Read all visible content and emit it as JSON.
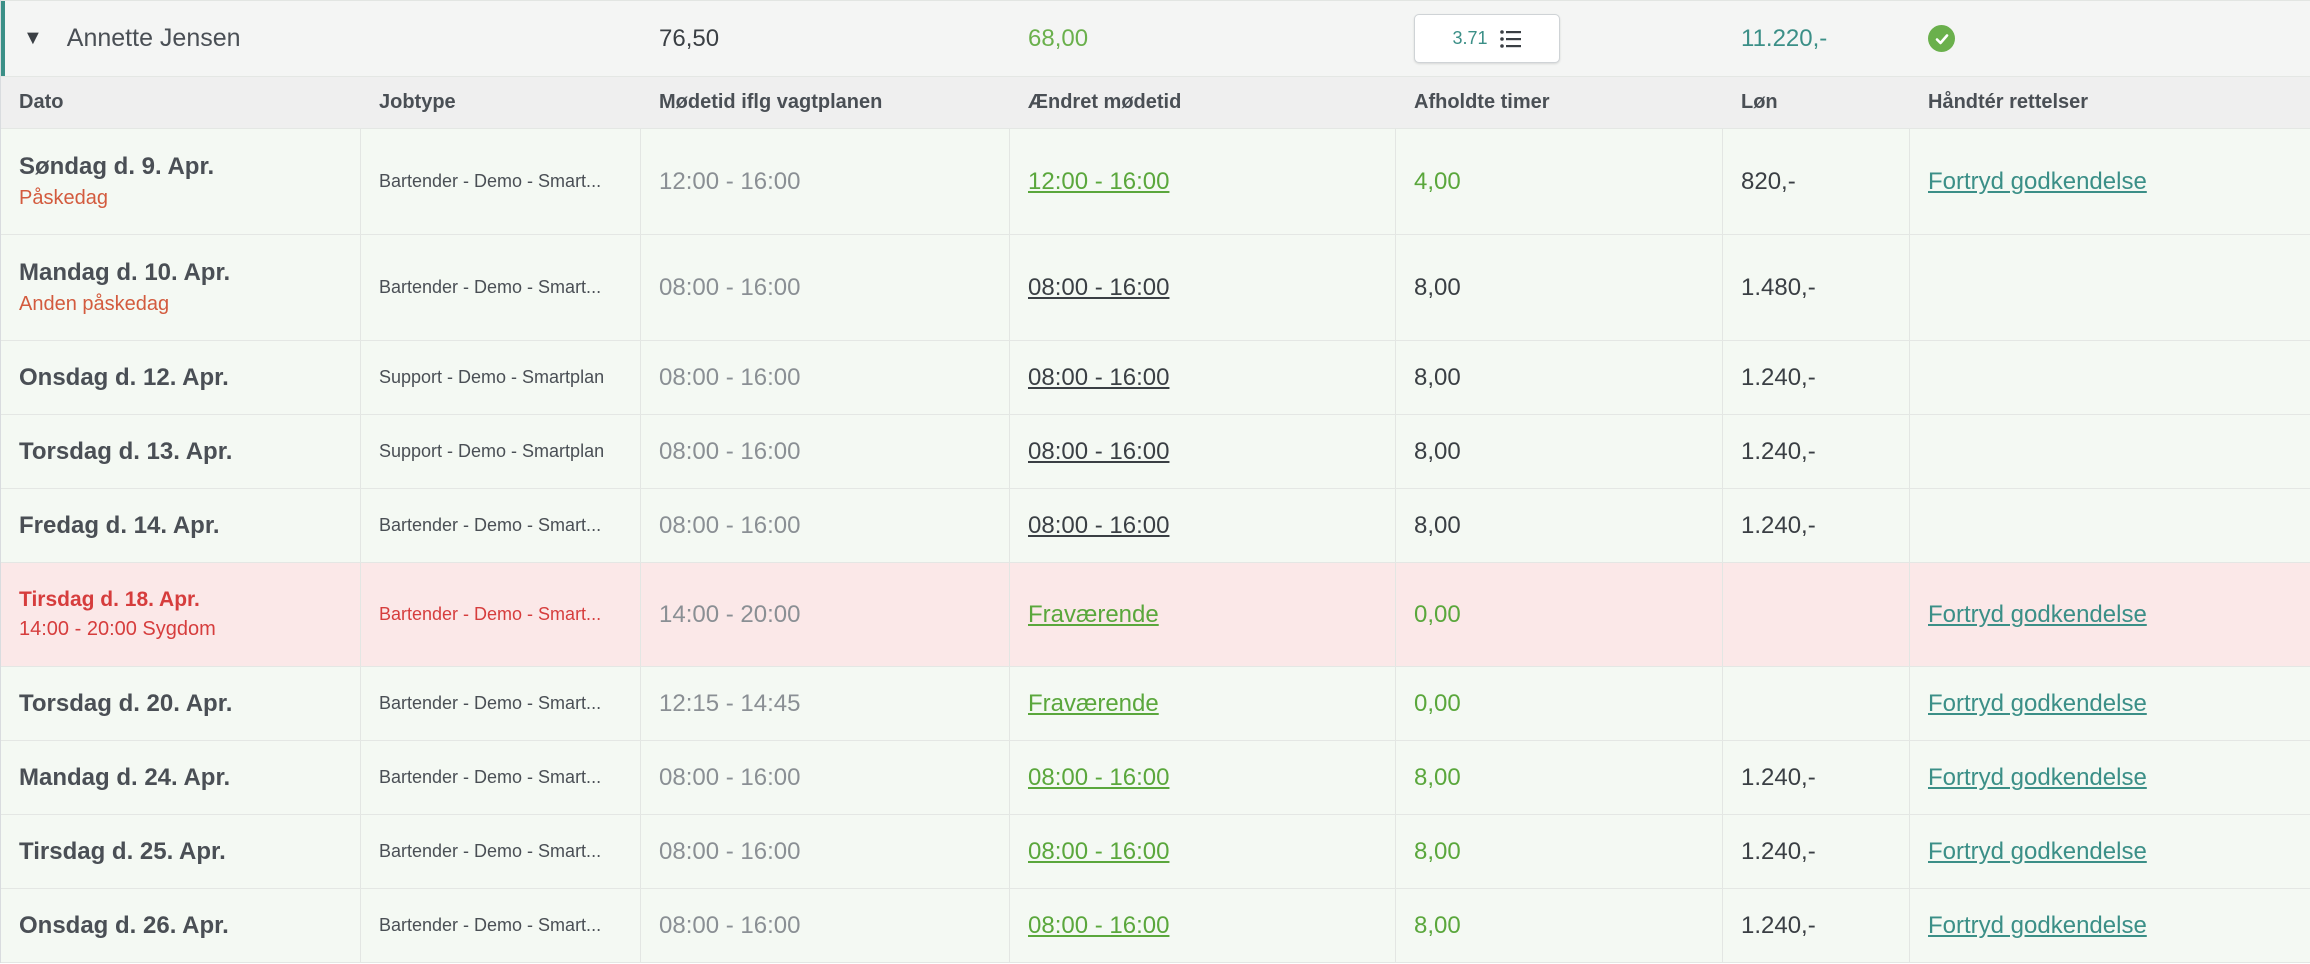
{
  "employee": {
    "name": "Annette Jensen",
    "hours": "76,50",
    "approved_hours": "68,00",
    "detail_value": "3.71",
    "total_wage": "11.220,-"
  },
  "columns": [
    "Dato",
    "Jobtype",
    "Mødetid iflg vagtplanen",
    "Ændret mødetid",
    "Afholdte timer",
    "Løn",
    "Håndtér rettelser"
  ],
  "rows": [
    {
      "date": "Søndag d. 9. Apr.",
      "note": "Påskedag",
      "job": "Bartender - Demo - Smart...",
      "scheduled": "12:00 - 16:00",
      "changed": "12:00 - 16:00",
      "hours": "4,00",
      "wage": "820,-",
      "action": "Fortryd godkendelse"
    },
    {
      "date": "Mandag d. 10. Apr.",
      "note": "Anden påskedag",
      "job": "Bartender - Demo - Smart...",
      "scheduled": "08:00 - 16:00",
      "changed": "08:00 - 16:00",
      "hours": "8,00",
      "wage": "1.480,-",
      "action": ""
    },
    {
      "date": "Onsdag d. 12. Apr.",
      "note": "",
      "job": "Support - Demo - Smartplan",
      "scheduled": "08:00 - 16:00",
      "changed": "08:00 - 16:00",
      "hours": "8,00",
      "wage": "1.240,-",
      "action": ""
    },
    {
      "date": "Torsdag d. 13. Apr.",
      "note": "",
      "job": "Support - Demo - Smartplan",
      "scheduled": "08:00 - 16:00",
      "changed": "08:00 - 16:00",
      "hours": "8,00",
      "wage": "1.240,-",
      "action": ""
    },
    {
      "date": "Fredag d. 14. Apr.",
      "note": "",
      "job": "Bartender - Demo - Smart...",
      "scheduled": "08:00 - 16:00",
      "changed": "08:00 - 16:00",
      "hours": "8,00",
      "wage": "1.240,-",
      "action": ""
    },
    {
      "date": "Tirsdag d. 18. Apr.",
      "note": "14:00 - 20:00 Sygdom",
      "job": "Bartender - Demo - Smart...",
      "scheduled": "14:00 - 20:00",
      "changed": "Fraværende",
      "hours": "0,00",
      "wage": "",
      "action": "Fortryd godkendelse"
    },
    {
      "date": "Torsdag d. 20. Apr.",
      "note": "",
      "job": "Bartender - Demo - Smart...",
      "scheduled": "12:15 - 14:45",
      "changed": "Fraværende",
      "hours": "0,00",
      "wage": "",
      "action": "Fortryd godkendelse"
    },
    {
      "date": "Mandag d. 24. Apr.",
      "note": "",
      "job": "Bartender - Demo - Smart...",
      "scheduled": "08:00 - 16:00",
      "changed": "08:00 - 16:00",
      "hours": "8,00",
      "wage": "1.240,-",
      "action": "Fortryd godkendelse"
    },
    {
      "date": "Tirsdag d. 25. Apr.",
      "note": "",
      "job": "Bartender - Demo - Smart...",
      "scheduled": "08:00 - 16:00",
      "changed": "08:00 - 16:00",
      "hours": "8,00",
      "wage": "1.240,-",
      "action": "Fortryd godkendelse"
    },
    {
      "date": "Onsdag d. 26. Apr.",
      "note": "",
      "job": "Bartender - Demo - Smart...",
      "scheduled": "08:00 - 16:00",
      "changed": "08:00 - 16:00",
      "hours": "8,00",
      "wage": "1.240,-",
      "action": "Fortryd godkendelse"
    }
  ],
  "colors": {
    "accent": "#3b8f87",
    "approved_green": "#5aa73c",
    "holiday_text": "#d35b3e",
    "absence_red": "#d63d3d",
    "absence_bg": "#fbe8e8",
    "row_bg": "#f4f9f3"
  }
}
